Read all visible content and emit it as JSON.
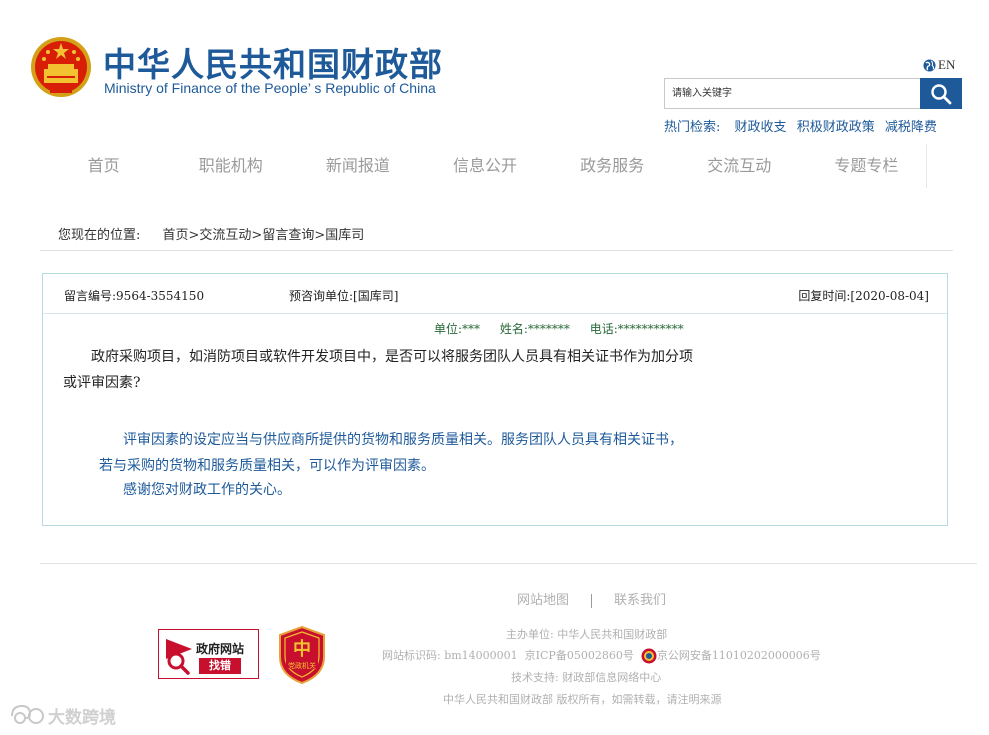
{
  "header": {
    "title_cn": "中华人民共和国财政部",
    "title_en": "Ministry of Finance of the People’ s Republic of China",
    "lang_label": "EN",
    "search_placeholder": "请输入关键字",
    "hot_label": "热门检索:",
    "hot_items": [
      "财政收支",
      "积极财政政策",
      "减税降费"
    ]
  },
  "nav": [
    "首页",
    "职能机构",
    "新闻报道",
    "信息公开",
    "政务服务",
    "交流互动",
    "专题专栏"
  ],
  "breadcrumb": {
    "label": "您现在的位置:",
    "path": "首页>交流互动>留言查询>国库司"
  },
  "message": {
    "id": "留言编号:9564-3554150",
    "unit": "预咨询单位:[国库司]",
    "reply_time": "回复时间:[2020-08-04]",
    "asker_unit": "单位:***",
    "asker_name": "姓名:*******",
    "asker_phone": "电话:***********",
    "question": "政府采购项目，如消防项目或软件开发项目中，是否可以将服务团队人员具有相关证书作为加分项或评审因素?",
    "answer": "评审因素的设定应当与供应商所提供的货物和服务质量相关。服务团队人员具有相关证书，若与采购的货物和服务质量相关，可以作为评审因素。",
    "thanks": "感谢您对财政工作的关心。"
  },
  "footer": {
    "link_sitemap": "网站地图",
    "link_contact": "联系我们",
    "host": "主办单位: 中华人民共和国财政部",
    "site_id": "网站标识码: bm14000001",
    "icp": "京ICP备05002860号",
    "police": "京公网安备11010202000006号",
    "tech": "技术支持: 财政部信息网络中心",
    "copyright": "中华人民共和国财政部 版权所有，如需转载，请注明来源",
    "govbadge_title": "政府网站",
    "govbadge_sub": "找错",
    "partybadge_text": "党政机关"
  },
  "watermark": "大数跨境",
  "colors": {
    "brand_blue": "#1e5a9a",
    "nav_gray": "#9a9a9a",
    "asker_green": "#2a6a3a",
    "box_border": "#b7dbe0",
    "badge_red": "#c8102e"
  }
}
